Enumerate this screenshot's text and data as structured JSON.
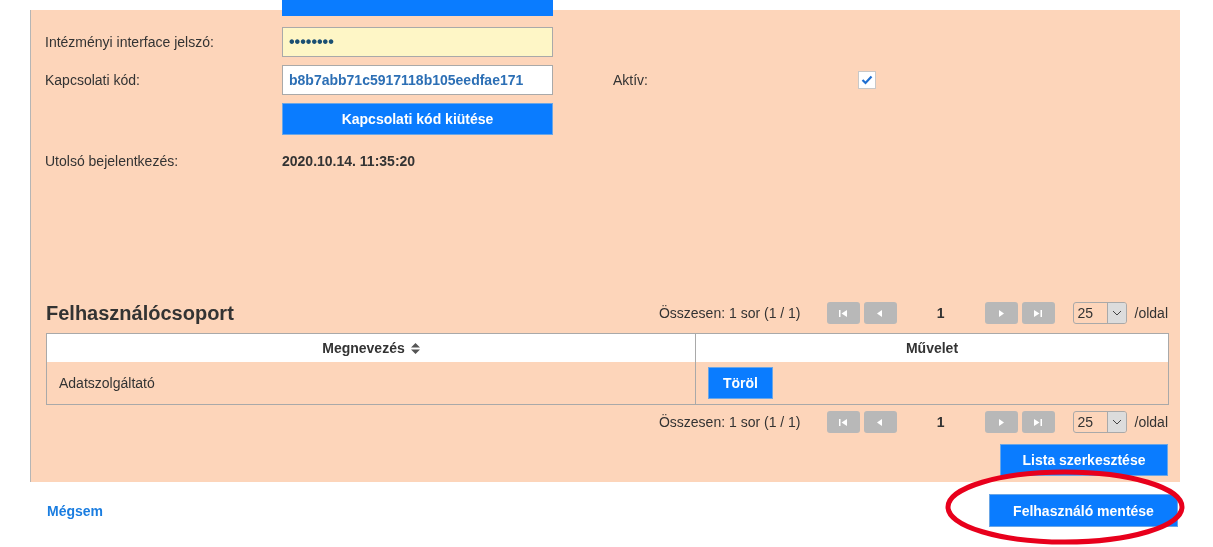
{
  "password": {
    "label": "Intézményi interface jelszó:",
    "value": "••••••••"
  },
  "connection_code": {
    "label": "Kapcsolati kód:",
    "value": "b8b7abb71c5917118b105eedfae171"
  },
  "active": {
    "label": "Aktív:",
    "checked": true
  },
  "kick_button": "Kapcsolati kód kiütése",
  "last_login": {
    "label": "Utolsó bejelentkezés:",
    "value": "2020.10.14. 11:35:20"
  },
  "group": {
    "title": "Felhasználócsoport",
    "pager_top": {
      "summary": "Összesen: 1 sor (1 / 1)",
      "page": "1",
      "page_size": "25",
      "per_page": "/oldal"
    },
    "columns": [
      {
        "label": "Megnevezés",
        "sortable": true
      },
      {
        "label": "Művelet",
        "sortable": false
      }
    ],
    "rows": [
      {
        "name": "Adatszolgáltató",
        "action": "Töröl"
      }
    ],
    "pager_bottom": {
      "summary": "Összesen: 1 sor (1 / 1)",
      "page": "1",
      "page_size": "25",
      "per_page": "/oldal"
    },
    "edit_button": "Lista szerkesztése"
  },
  "cancel_link": "Mégsem",
  "save_button": "Felhasználó mentése"
}
